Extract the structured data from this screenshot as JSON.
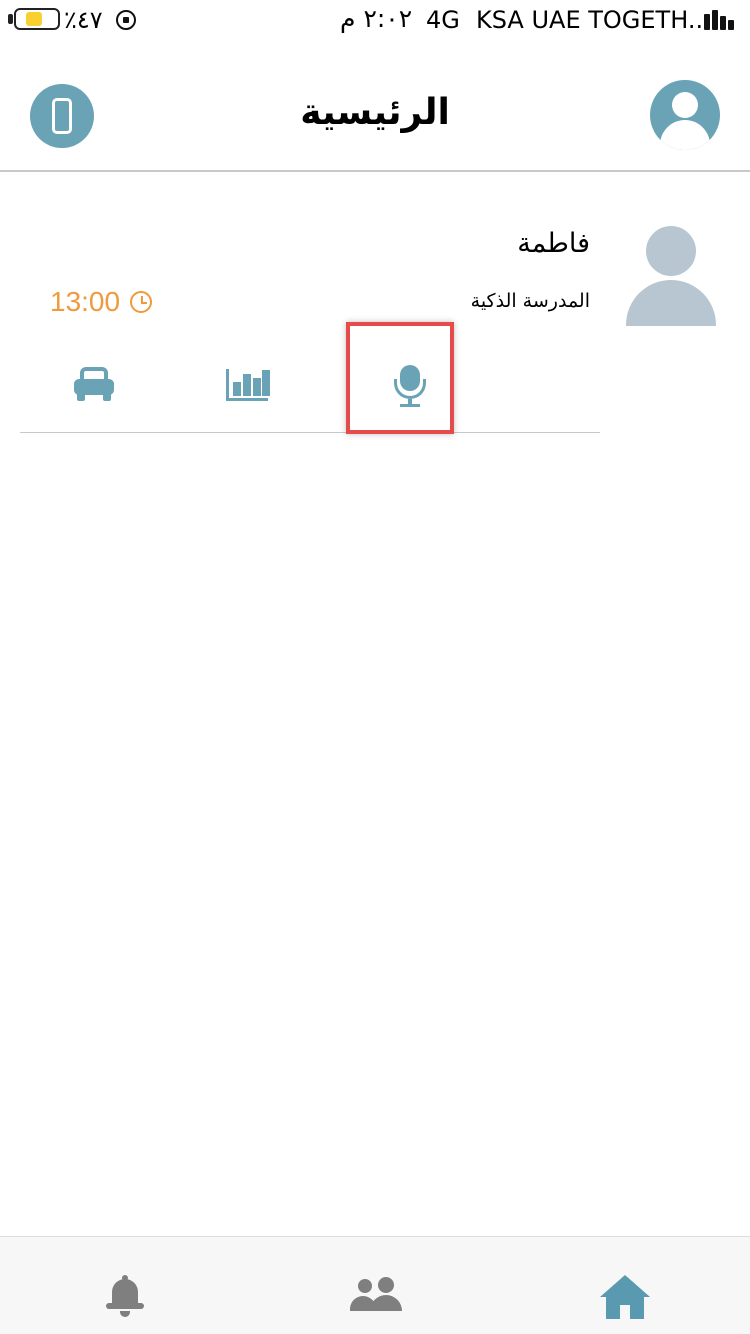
{
  "status_bar": {
    "battery_text": "٪٤٧",
    "time": "٢:٠٢ م",
    "network": "4G",
    "carrier": "KSA UAE TOGETH...",
    "battery_color": "#f8d030"
  },
  "header": {
    "title": "الرئيسية",
    "left_icon": "phone-icon",
    "right_icon": "user-avatar-icon",
    "accent_color": "#6aa3b5"
  },
  "student": {
    "name": "فاطمة",
    "school": "المدرسة الذكية",
    "time": "13:00",
    "time_color": "#f09a3e",
    "actions": [
      {
        "icon": "car-icon"
      },
      {
        "icon": "bar-chart-icon"
      },
      {
        "icon": "microphone-icon",
        "highlighted": true
      }
    ]
  },
  "tabbar": {
    "tabs": [
      {
        "icon": "bell-icon",
        "active": false
      },
      {
        "icon": "people-icon",
        "active": false
      },
      {
        "icon": "home-icon",
        "active": true
      }
    ],
    "active_color": "#5a9ab0",
    "inactive_color": "#7f7f7f"
  }
}
